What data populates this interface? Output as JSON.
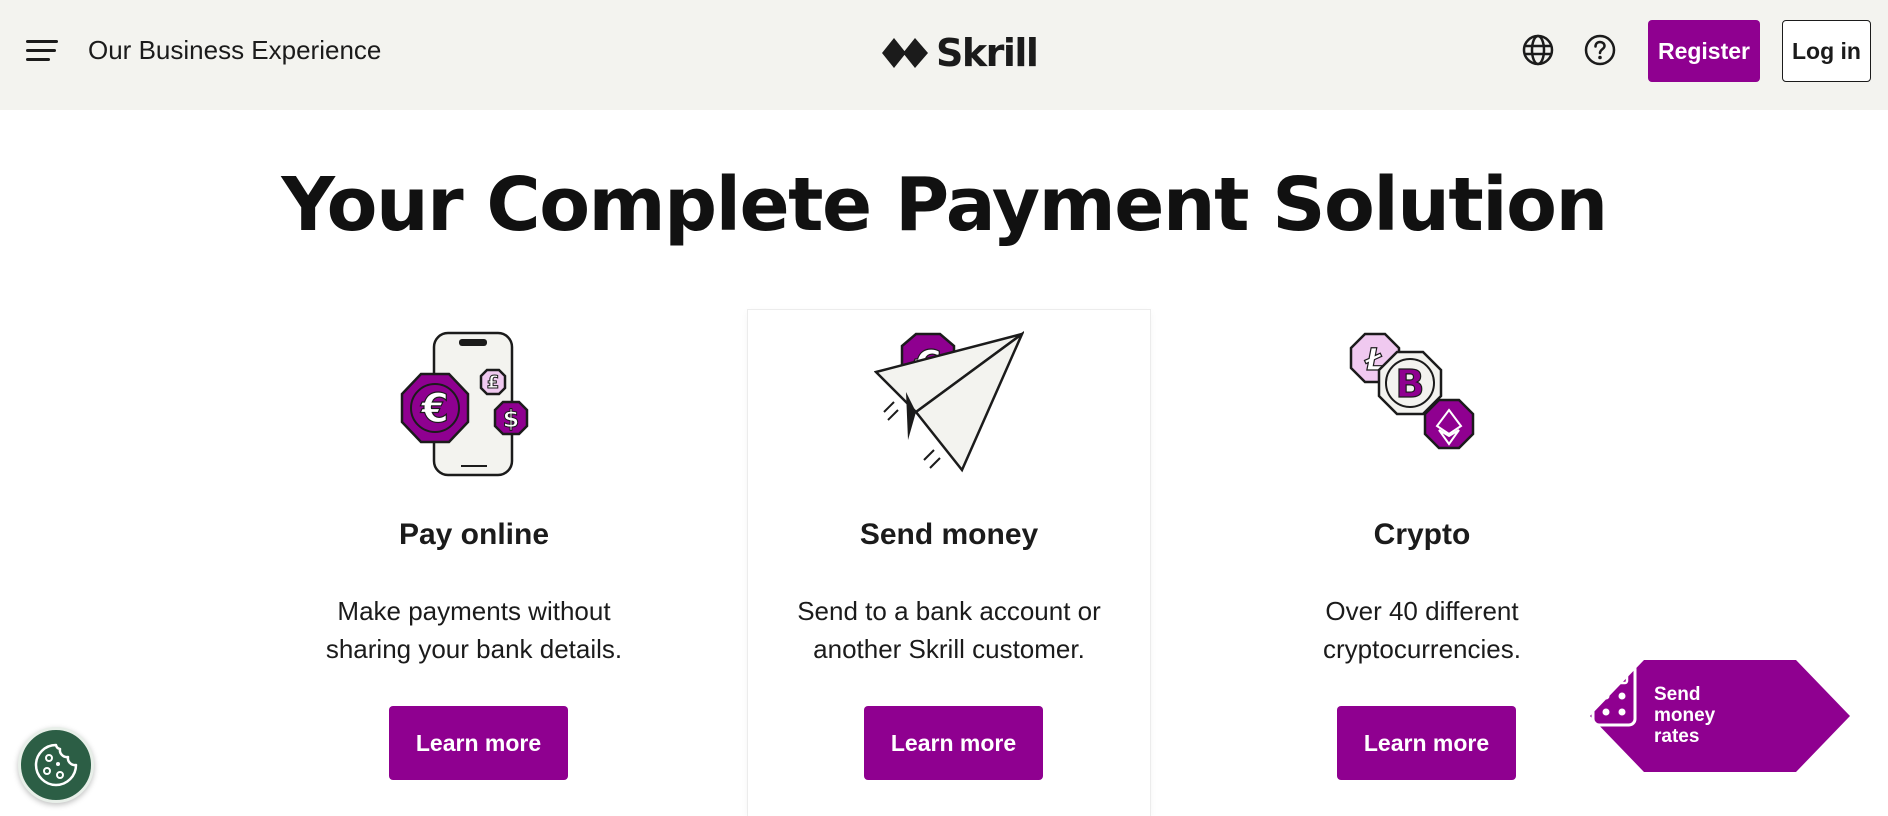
{
  "header": {
    "menu_icon": "hamburger-menu-icon",
    "business_link": "Our Business Experience",
    "logo_text": "Skrill",
    "globe_icon": "globe-icon",
    "help_icon": "question-circle-icon",
    "register_label": "Register",
    "login_label": "Log in"
  },
  "hero": {
    "title": "Your Complete Payment Solution"
  },
  "cards": [
    {
      "icon": "phone-currency-coins-icon",
      "title": "Pay online",
      "description": "Make payments without sharing your bank details.",
      "button": "Learn more"
    },
    {
      "icon": "paper-plane-euro-icon",
      "title": "Send money",
      "description": "Send to a bank account or another Skrill customer.",
      "button": "Learn more"
    },
    {
      "icon": "crypto-coins-icon",
      "title": "Crypto",
      "description": "Over 40 different cryptocurrencies.",
      "button": "Learn more"
    }
  ],
  "rates_widget": {
    "label": "Send money rates",
    "icon": "calculator-icon"
  },
  "cookie": {
    "icon": "cookie-icon"
  },
  "colors": {
    "brand_purple": "#8f0090",
    "header_bg": "#f3f3ef",
    "cookie_green": "#2c5e45"
  }
}
